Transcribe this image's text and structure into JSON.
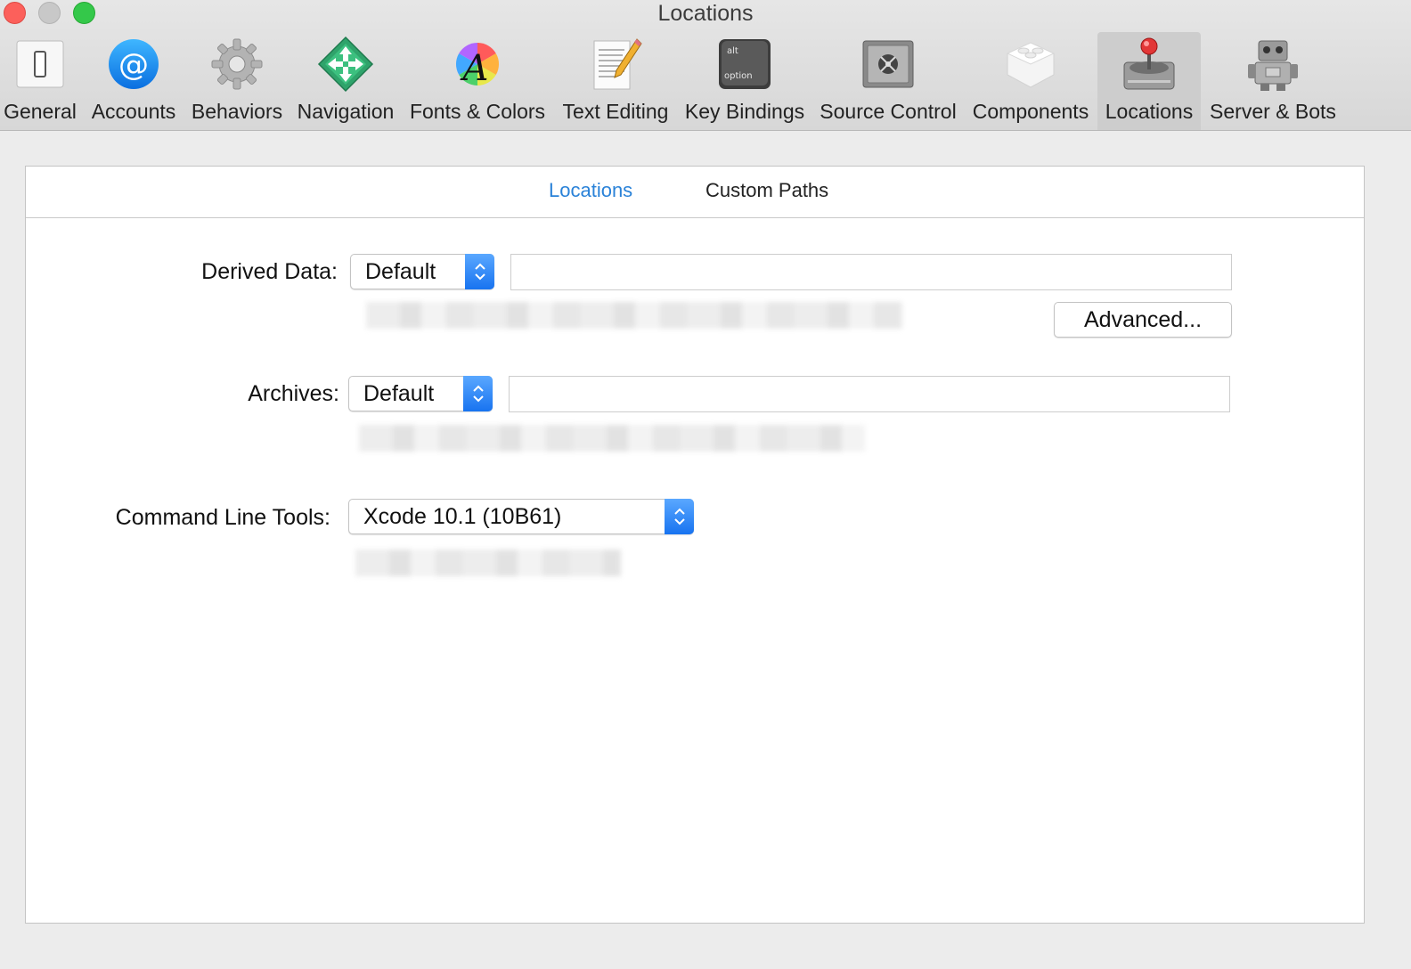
{
  "window": {
    "title": "Locations"
  },
  "toolbar": {
    "items": [
      {
        "label": "General",
        "icon": "general-icon"
      },
      {
        "label": "Accounts",
        "icon": "at-sign-icon"
      },
      {
        "label": "Behaviors",
        "icon": "gear-icon"
      },
      {
        "label": "Navigation",
        "icon": "arrows-icon"
      },
      {
        "label": "Fonts & Colors",
        "icon": "font-color-wheel-icon"
      },
      {
        "label": "Text Editing",
        "icon": "pencil-document-icon"
      },
      {
        "label": "Key Bindings",
        "icon": "option-key-icon"
      },
      {
        "label": "Source Control",
        "icon": "safe-icon"
      },
      {
        "label": "Components",
        "icon": "lego-block-icon"
      },
      {
        "label": "Locations",
        "icon": "joystick-drive-icon",
        "selected": true
      },
      {
        "label": "Server & Bots",
        "icon": "robot-icon"
      }
    ],
    "key_icon_text": {
      "top": "alt",
      "bottom": "option"
    }
  },
  "tabs": [
    {
      "label": "Locations",
      "active": true
    },
    {
      "label": "Custom Paths",
      "active": false
    }
  ],
  "derived_data": {
    "label": "Derived Data:",
    "value": "Default",
    "path_value": ""
  },
  "archives": {
    "label": "Archives:",
    "value": "Default",
    "path_value": ""
  },
  "command_line_tools": {
    "label": "Command Line Tools:",
    "value": "Xcode 10.1 (10B61)"
  },
  "advanced_button": {
    "label": "Advanced..."
  },
  "colors": {
    "accent": "#2a82d8",
    "popup_arrow": "#1873f0"
  }
}
